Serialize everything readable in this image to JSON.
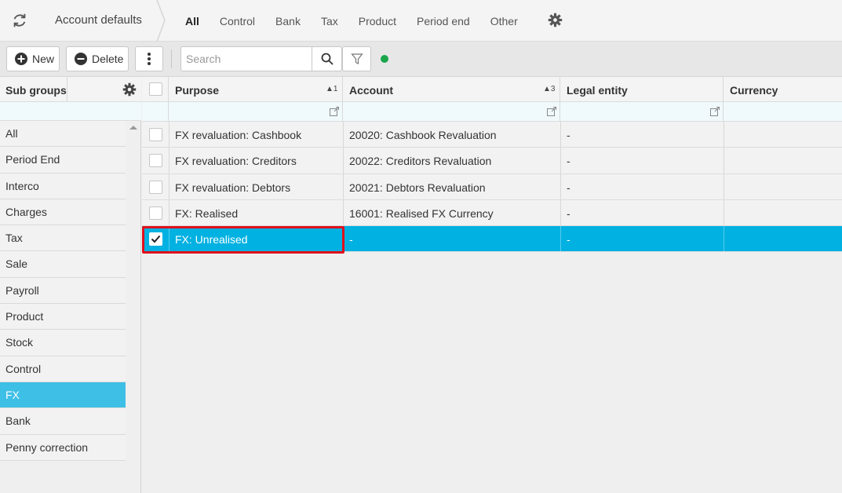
{
  "topbar": {
    "title": "Account defaults",
    "tabs": [
      {
        "label": "All",
        "active": true
      },
      {
        "label": "Control",
        "active": false
      },
      {
        "label": "Bank",
        "active": false
      },
      {
        "label": "Tax",
        "active": false
      },
      {
        "label": "Product",
        "active": false
      },
      {
        "label": "Period end",
        "active": false
      },
      {
        "label": "Other",
        "active": false
      }
    ]
  },
  "toolbar": {
    "new_label": "New",
    "delete_label": "Delete",
    "search_placeholder": "Search",
    "status_color": "#1aa64b"
  },
  "subgroups": {
    "title": "Sub groups",
    "items": [
      {
        "label": "All",
        "selected": false
      },
      {
        "label": "Period End",
        "selected": false
      },
      {
        "label": "Interco",
        "selected": false
      },
      {
        "label": "Charges",
        "selected": false
      },
      {
        "label": "Tax",
        "selected": false
      },
      {
        "label": "Sale",
        "selected": false
      },
      {
        "label": "Payroll",
        "selected": false
      },
      {
        "label": "Product",
        "selected": false
      },
      {
        "label": "Stock",
        "selected": false
      },
      {
        "label": "Control",
        "selected": false
      },
      {
        "label": "FX",
        "selected": true
      },
      {
        "label": "Bank",
        "selected": false
      },
      {
        "label": "Penny correction",
        "selected": false
      }
    ]
  },
  "grid": {
    "columns": [
      {
        "label": "Purpose",
        "sort": "▲1"
      },
      {
        "label": "Account",
        "sort": "▲3"
      },
      {
        "label": "Legal entity",
        "sort": ""
      },
      {
        "label": "Currency",
        "sort": ""
      }
    ],
    "rows": [
      {
        "purpose": "FX revaluation: Cashbook",
        "account": "20020: Cashbook Revaluation",
        "legal_entity": "-",
        "currency": "",
        "checked": false,
        "selected": false
      },
      {
        "purpose": "FX revaluation: Creditors",
        "account": "20022: Creditors Revaluation",
        "legal_entity": "-",
        "currency": "",
        "checked": false,
        "selected": false
      },
      {
        "purpose": "FX revaluation: Debtors",
        "account": "20021: Debtors Revaluation",
        "legal_entity": "-",
        "currency": "",
        "checked": false,
        "selected": false
      },
      {
        "purpose": "FX: Realised",
        "account": "16001: Realised FX Currency",
        "legal_entity": "-",
        "currency": "",
        "checked": false,
        "selected": false
      },
      {
        "purpose": "FX: Unrealised",
        "account": "-",
        "legal_entity": "-",
        "currency": "",
        "checked": true,
        "selected": true
      }
    ]
  },
  "colors": {
    "selected_row": "#00b1e1",
    "selected_subgroup": "#3ebfe6",
    "highlight_border": "#e0101c"
  }
}
